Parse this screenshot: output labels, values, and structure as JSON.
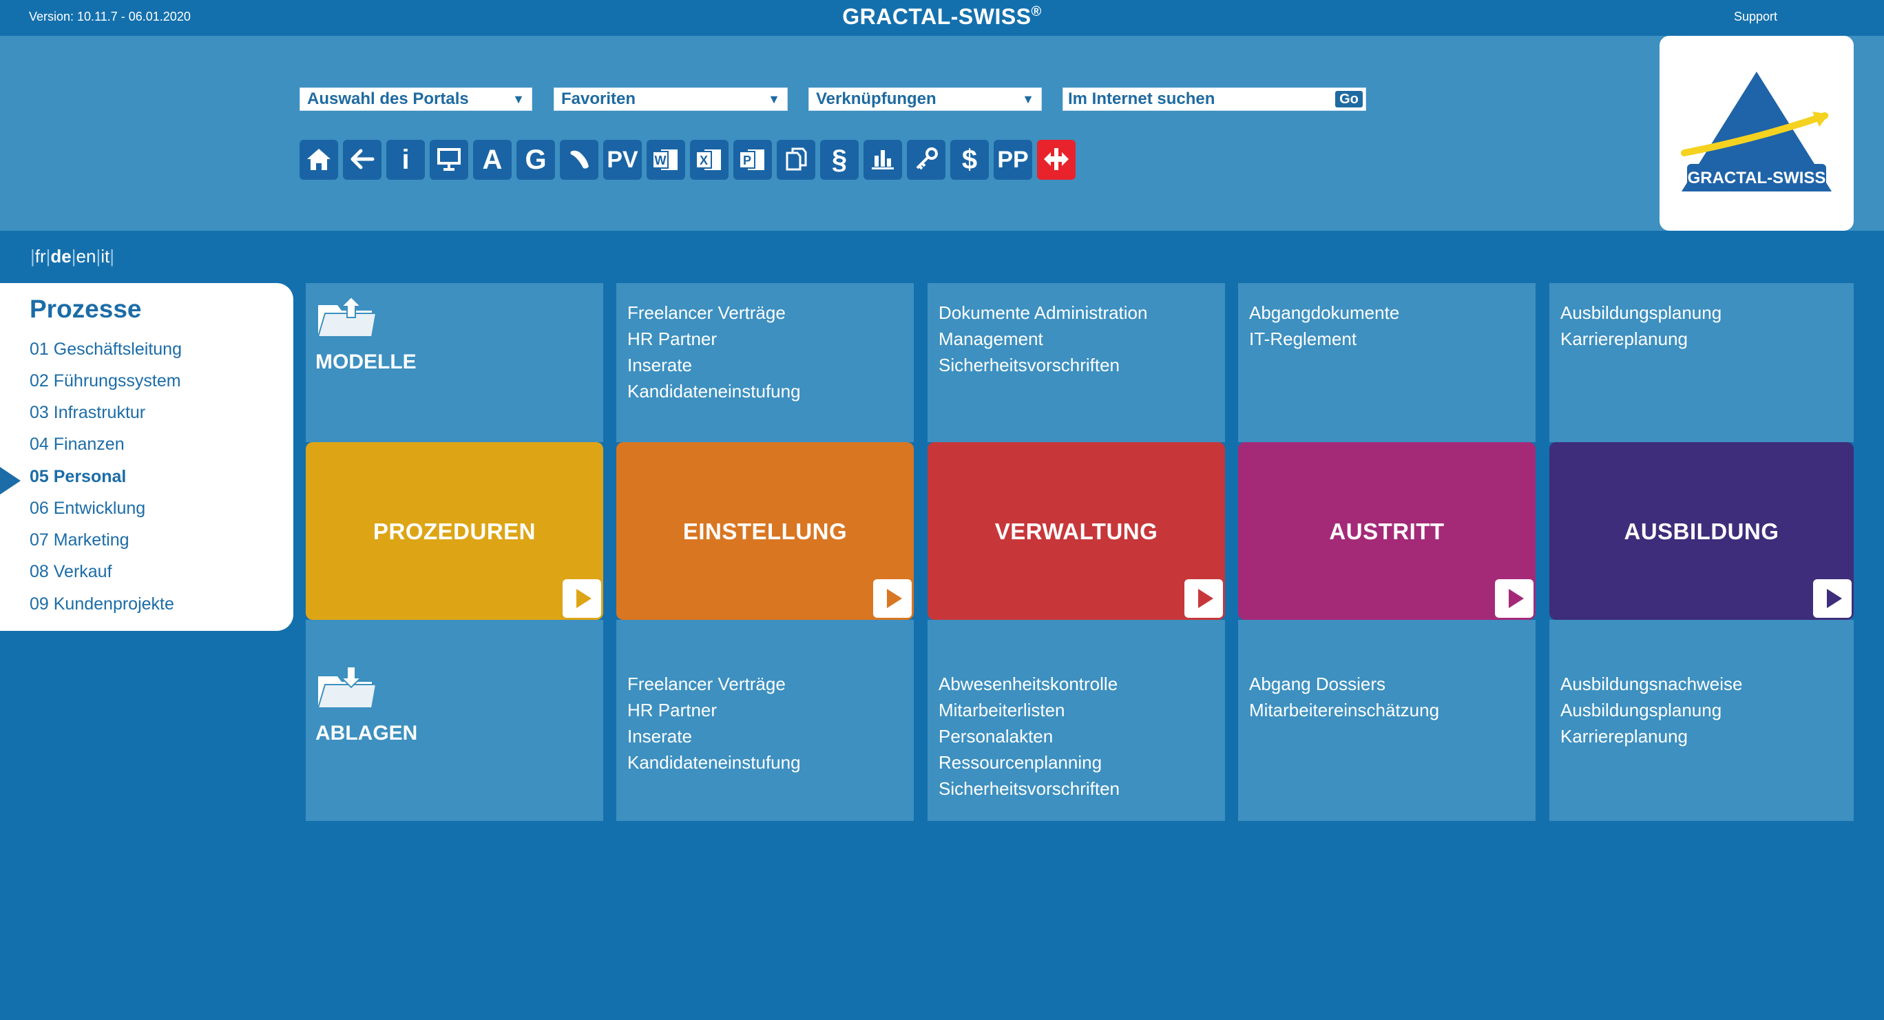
{
  "topbar": {
    "version": "Version: 10.11.7 - 06.01.2020",
    "brand": "GRACTAL-SWISS",
    "brand_mark": "®",
    "support": "Support"
  },
  "toolbar": {
    "portal_select": "Auswahl des Portals",
    "favorites_select": "Favoriten",
    "links_select": "Verknüpfungen",
    "search_placeholder": "Im Internet suchen",
    "search_go": "Go",
    "icons": [
      {
        "name": "home-icon"
      },
      {
        "name": "back-arrow-icon"
      },
      {
        "name": "info-icon",
        "label": "i"
      },
      {
        "name": "presentation-icon"
      },
      {
        "name": "letter-a-icon",
        "label": "A"
      },
      {
        "name": "letter-g-icon",
        "label": "G"
      },
      {
        "name": "phone-icon"
      },
      {
        "name": "pv-icon",
        "label": "PV"
      },
      {
        "name": "word-icon",
        "label": "W"
      },
      {
        "name": "excel-icon",
        "label": "X"
      },
      {
        "name": "powerpoint-icon",
        "label": "P"
      },
      {
        "name": "copy-icon"
      },
      {
        "name": "paragraph-icon",
        "label": "§"
      },
      {
        "name": "bar-chart-icon"
      },
      {
        "name": "key-icon"
      },
      {
        "name": "dollar-icon",
        "label": "$"
      },
      {
        "name": "pp-icon",
        "label": "PP"
      },
      {
        "name": "swiss-railway-icon"
      }
    ]
  },
  "logo": {
    "text": "GRACTAL-SWISS"
  },
  "languages": [
    "fr",
    "de",
    "en",
    "it"
  ],
  "active_language": "de",
  "sidebar": {
    "title": "Prozesse",
    "items": [
      {
        "label": "01 Geschäftsleitung"
      },
      {
        "label": "02 Führungssystem"
      },
      {
        "label": "03 Infrastruktur"
      },
      {
        "label": "04 Finanzen"
      },
      {
        "label": "05 Personal",
        "active": true
      },
      {
        "label": "06 Entwicklung"
      },
      {
        "label": "07 Marketing"
      },
      {
        "label": "08 Verkauf"
      },
      {
        "label": "09 Kundenprojekte"
      }
    ]
  },
  "grid": {
    "modelle_label": "MODELLE",
    "ablagen_label": "ABLAGEN",
    "columns": [
      {
        "title": "PROZEDUREN",
        "color": "#dda516",
        "top": [],
        "bottom": []
      },
      {
        "title": "EINSTELLUNG",
        "color": "#d97622",
        "top": [
          "Freelancer Verträge",
          "HR Partner",
          "Inserate",
          "Kandidateneinstufung"
        ],
        "bottom": [
          "Freelancer Verträge",
          "HR Partner",
          "Inserate",
          "Kandidateneinstufung"
        ]
      },
      {
        "title": "VERWALTUNG",
        "color": "#c7373a",
        "top": [
          "Dokumente Administration",
          "Management",
          "Sicherheitsvorschriften"
        ],
        "bottom": [
          "Abwesenheitskontrolle",
          "Mitarbeiterlisten",
          "Personalakten",
          "Ressourcenplanning",
          "Sicherheitsvorschriften"
        ]
      },
      {
        "title": "AUSTRITT",
        "color": "#a42a78",
        "top": [
          "Abgangdokumente",
          "IT-Reglement"
        ],
        "bottom": [
          "Abgang Dossiers",
          "Mitarbeitereinschätzung"
        ]
      },
      {
        "title": "AUSBILDUNG",
        "color": "#3e2d7a",
        "top": [
          "Ausbildungsplanung",
          "Karriereplanung"
        ],
        "bottom": [
          "Ausbildungsnachweise",
          "Ausbildungsplanung",
          "Karriereplanung"
        ]
      }
    ]
  }
}
